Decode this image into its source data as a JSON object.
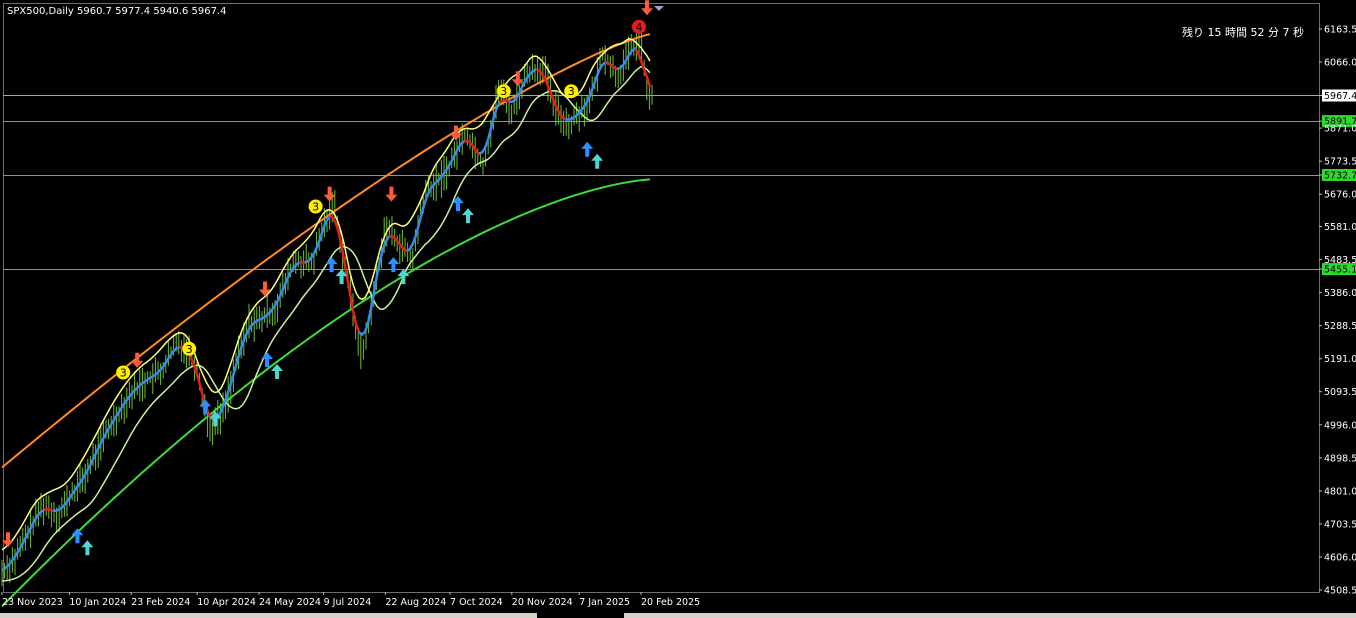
{
  "header": {
    "symbol_info": "SPX500,Daily  5960.7 5977.4 5940.6 5967.4",
    "timer_text": "残り 15 時間 52 分 7 秒"
  },
  "colors": {
    "background": "#000000",
    "candle": "#6fbf2f",
    "level_line": "#2ed82e",
    "current_price_line": "#9aa6c8",
    "band_yellow": "#ffff7a",
    "band_orange": "#ff8a2a",
    "trend_red": "#e51c1c",
    "trend_blue": "#2f8fe8",
    "ma_light_green": "#c9f29a",
    "long_ma_green": "#3ddc3d",
    "arrow_down": "#ff5a3a",
    "arrow_up_blue": "#2b8fff",
    "arrow_up_teal": "#4fd6d0",
    "marker_yellow": "#ffee00"
  },
  "chart_data": {
    "type": "line",
    "price_axis_ticks": [
      "6163.5",
      "6066.0",
      "5967.4",
      "5891.7",
      "5871.0",
      "5773.5",
      "5732.7",
      "5676.0",
      "5581.0",
      "5483.5",
      "5455.1",
      "5386.0",
      "5288.5",
      "5191.0",
      "5093.5",
      "4996.0",
      "4898.5",
      "4801.0",
      "4703.5",
      "4606.0",
      "4508.5"
    ],
    "date_axis_ticks": [
      "23 Nov 2023",
      "10 Jan 2024",
      "23 Feb 2024",
      "10 Apr 2024",
      "24 May 2024",
      "9 Jul 2024",
      "22 Aug 2024",
      "7 Oct 2024",
      "20 Nov 2024",
      "7 Jan 2025",
      "20 Feb 2025"
    ],
    "current_price": 5967.4,
    "horizontal_levels": [
      5891.7,
      5732.7,
      5455.1
    ],
    "ylim": [
      4508.5,
      6190
    ],
    "ohlc_last": {
      "open": 5960.7,
      "high": 5977.4,
      "low": 5940.6,
      "close": 5967.4
    },
    "close_path": [
      [
        "23 Nov 2023",
        4560
      ],
      [
        "2 Dec 2023",
        4600
      ],
      [
        "12 Dec 2023",
        4680
      ],
      [
        "22 Dec 2023",
        4760
      ],
      [
        "2 Jan 2024",
        4730
      ],
      [
        "10 Jan 2024",
        4780
      ],
      [
        "22 Jan 2024",
        4850
      ],
      [
        "2 Feb 2024",
        4950
      ],
      [
        "12 Feb 2024",
        5020
      ],
      [
        "23 Feb 2024",
        5090
      ],
      [
        "5 Mar 2024",
        5130
      ],
      [
        "15 Mar 2024",
        5150
      ],
      [
        "27 Mar 2024",
        5240
      ],
      [
        "5 Apr 2024",
        5210
      ],
      [
        "10 Apr 2024",
        5160
      ],
      [
        "19 Apr 2024",
        4980
      ],
      [
        "29 Apr 2024",
        5040
      ],
      [
        "8 May 2024",
        5180
      ],
      [
        "17 May 2024",
        5300
      ],
      [
        "24 May 2024",
        5300
      ],
      [
        "5 Jun 2024",
        5340
      ],
      [
        "18 Jun 2024",
        5480
      ],
      [
        "1 Jul 2024",
        5470
      ],
      [
        "9 Jul 2024",
        5580
      ],
      [
        "16 Jul 2024",
        5660
      ],
      [
        "25 Jul 2024",
        5450
      ],
      [
        "5 Aug 2024",
        5190
      ],
      [
        "12 Aug 2024",
        5340
      ],
      [
        "22 Aug 2024",
        5580
      ],
      [
        "3 Sep 2024",
        5520
      ],
      [
        "10 Sep 2024",
        5480
      ],
      [
        "19 Sep 2024",
        5680
      ],
      [
        "30 Sep 2024",
        5720
      ],
      [
        "7 Oct 2024",
        5760
      ],
      [
        "18 Oct 2024",
        5860
      ],
      [
        "31 Oct 2024",
        5760
      ],
      [
        "11 Nov 2024",
        5990
      ],
      [
        "20 Nov 2024",
        5920
      ],
      [
        "2 Dec 2024",
        6040
      ],
      [
        "13 Dec 2024",
        6050
      ],
      [
        "20 Dec 2024",
        5930
      ],
      [
        "31 Dec 2024",
        5880
      ],
      [
        "7 Jan 2025",
        5920
      ],
      [
        "15 Jan 2025",
        5950
      ],
      [
        "24 Jan 2025",
        6100
      ],
      [
        "3 Feb 2025",
        6020
      ],
      [
        "14 Feb 2025",
        6110
      ],
      [
        "20 Feb 2025",
        6130
      ],
      [
        "25 Feb 2025",
        5950
      ],
      [
        "28 Feb 2025",
        5967.4
      ]
    ],
    "signals_down": [
      "23 Nov 2023",
      "23 Feb 2024",
      "24 May 2024",
      "9 Jul 2024",
      "22 Aug 2024",
      "7 Oct 2024",
      "20 Nov 2024",
      "20 Feb 2025"
    ],
    "signals_up": [
      "10 Jan 2024",
      "10 Apr 2024",
      "24 May 2024",
      "9 Jul 2024",
      "22 Aug 2024",
      "7 Oct 2024",
      "7 Jan 2025"
    ],
    "markers_3": [
      "23 Feb 2024",
      "10 Apr 2024",
      "9 Jul 2024",
      "20 Nov 2024",
      "7 Jan 2025"
    ],
    "markers_4": [
      "20 Feb 2025"
    ],
    "grid": false
  }
}
